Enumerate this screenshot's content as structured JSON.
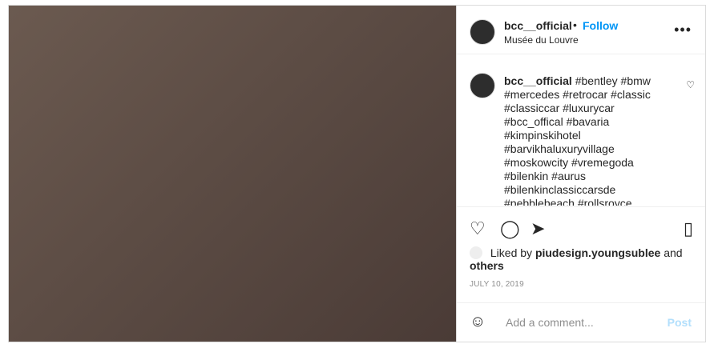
{
  "header": {
    "username": "bcc__official",
    "dot": "•",
    "follow": "Follow",
    "location": "Musée du Louvre",
    "more": "•••"
  },
  "caption": {
    "username": "bcc__official",
    "hashtags": "#bentley #bmw #mercedes #retrocar #classic #classiccar #luxurycar #bcc_offical #bavaria #kimpinskihotel #barvikhaluxuryvillage #moskowcity #vremegoda #bilenkin #aurus #bilenkinclassiccarsde #pebblebeach #rollsroyce"
  },
  "likes": {
    "prefix": "Liked by",
    "user": "piudesign.youngsublee",
    "and": "and",
    "others": "others"
  },
  "date": "JULY 10, 2019",
  "comment": {
    "placeholder": "Add a comment...",
    "post": "Post"
  }
}
